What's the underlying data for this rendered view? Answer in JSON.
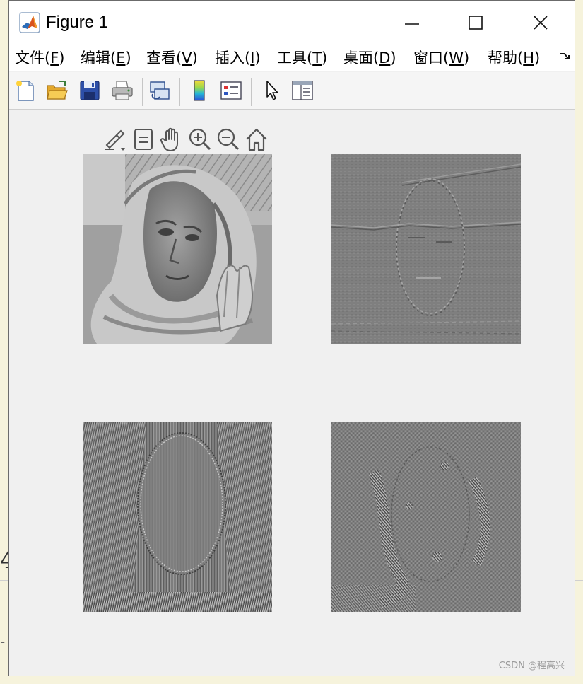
{
  "window": {
    "title": "Figure 1",
    "icon": "matlab-logo-icon"
  },
  "menu": [
    {
      "label": "文件(",
      "key": "F",
      "tail": ")"
    },
    {
      "label": "编辑(",
      "key": "E",
      "tail": ")"
    },
    {
      "label": "查看(",
      "key": "V",
      "tail": ")"
    },
    {
      "label": "插入(",
      "key": "I",
      "tail": ")"
    },
    {
      "label": "工具(",
      "key": "T",
      "tail": ")"
    },
    {
      "label": "桌面(",
      "key": "D",
      "tail": ")"
    },
    {
      "label": "窗口(",
      "key": "W",
      "tail": ")"
    },
    {
      "label": "帮助(",
      "key": "H",
      "tail": ")"
    }
  ],
  "toolbar": {
    "buttons": [
      "new-figure-icon",
      "open-folder-icon",
      "save-icon",
      "print-icon",
      "link-plot-icon",
      "insert-colorbar-icon",
      "insert-legend-icon",
      "edit-plot-arrow-icon",
      "property-inspector-icon"
    ]
  },
  "axes_toolbar": [
    "brush-icon",
    "data-tips-icon",
    "pan-hand-icon",
    "zoom-in-icon",
    "zoom-out-icon",
    "home-icon"
  ],
  "panels": [
    {
      "name": "original-image",
      "content": "grayscale portrait of woman in headscarf"
    },
    {
      "name": "filtered-image-1",
      "content": "horizontal edge detail"
    },
    {
      "name": "filtered-image-2",
      "content": "vertical high-frequency detail"
    },
    {
      "name": "filtered-image-3",
      "content": "diagonal high-frequency detail"
    }
  ],
  "background": {
    "digit": "4"
  },
  "watermark": "CSDN @程高兴"
}
